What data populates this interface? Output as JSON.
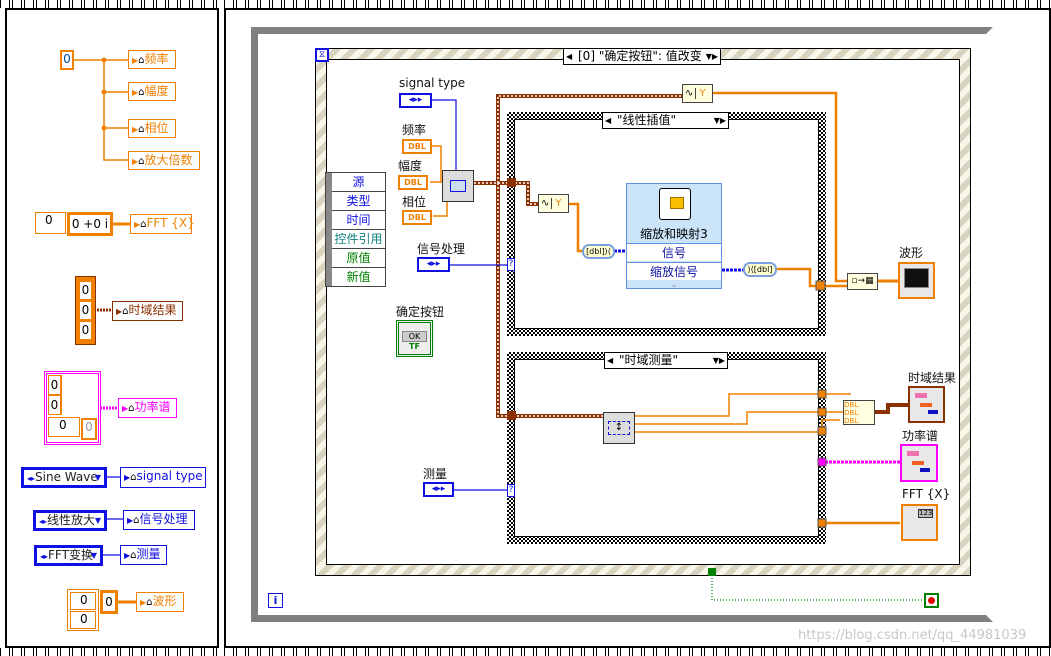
{
  "front_constants": {
    "zero": "0",
    "cluster_labels": [
      "频率",
      "幅度",
      "相位",
      "放大倍数"
    ],
    "complex_index": "0",
    "complex_value": "0 +0 i",
    "fft_label": "FFT {X}",
    "array_values": [
      "0",
      "0",
      "0"
    ],
    "time_result_label": "时域结果",
    "power_values": [
      "0",
      "0"
    ],
    "power_index": "0",
    "power_elem": "0",
    "power_label": "功率谱",
    "signal_type_value": "Sine Wave",
    "signal_type_label": "signal type",
    "process_value": "线性放大",
    "process_label": "信号处理",
    "measure_value": "FFT变换",
    "measure_label": "测量",
    "wave_index": [
      "0",
      "0"
    ],
    "wave_elem": "0",
    "wave_label": "波形"
  },
  "diagram": {
    "event_case": "[0] \"确定按钮\": 值改变",
    "event_data": [
      "源",
      "类型",
      "时间",
      "控件引用",
      "原值",
      "新值"
    ],
    "controls": {
      "signal_type": "signal type",
      "freq": "频率",
      "amp": "幅度",
      "phase": "相位",
      "process": "信号处理",
      "ok_button": "确定按钮",
      "measure": "测量",
      "dbl": "DBL",
      "ok": "OK",
      "tf": "TF"
    },
    "case1": "\"线性插值\"",
    "case2": "\"时域测量\"",
    "express_vi": {
      "title": "缩放和映射3",
      "inputs": [
        "信号"
      ],
      "outputs": [
        "缩放信号"
      ]
    },
    "get_y": "Y",
    "indicators": {
      "wave": "波形",
      "time_result": "时域结果",
      "power": "功率谱",
      "fft": "FFT {X}"
    },
    "selector_q": "?",
    "info": "i"
  },
  "watermark": "https://blog.csdn.net/qq_44981039",
  "colors": {
    "double": "#f08000",
    "enum": "#1010e0",
    "cluster": "#8b3000",
    "boolean": "#008000",
    "power": "#ff00ff"
  }
}
